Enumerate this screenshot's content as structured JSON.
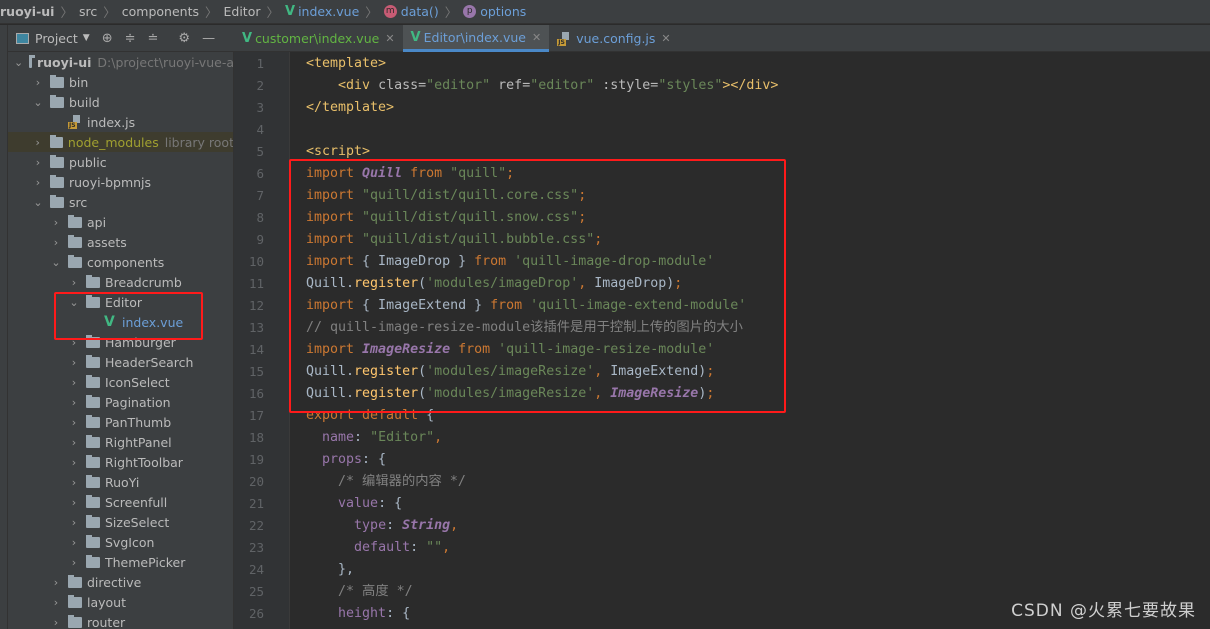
{
  "breadcrumb": {
    "items": [
      {
        "label": "ruoyi-ui",
        "icon": ""
      },
      {
        "label": "src",
        "icon": ""
      },
      {
        "label": "components",
        "icon": ""
      },
      {
        "label": "Editor",
        "icon": ""
      },
      {
        "label": "index.vue",
        "icon": "vue-icon"
      },
      {
        "label": "data()",
        "icon": "method-icon",
        "badge": "m",
        "color": "#c75b74"
      },
      {
        "label": "options",
        "icon": "property-icon",
        "badge": "p",
        "color": "#9876aa"
      }
    ]
  },
  "project_bar": {
    "label": "Project",
    "icons": [
      "locate-icon",
      "expand-all-icon",
      "collapse-all-icon",
      "gear-icon",
      "minimize-icon"
    ]
  },
  "tabs": [
    {
      "label": "customer\\index.vue",
      "icon": "vue-icon",
      "active": false,
      "color": "green"
    },
    {
      "label": "Editor\\index.vue",
      "icon": "vue-icon",
      "active": true,
      "color": "blue"
    },
    {
      "label": "vue.config.js",
      "icon": "js-icon",
      "active": false,
      "color": "blue"
    }
  ],
  "tree": [
    {
      "name": "ruoyi-ui",
      "hint": "D:\\project\\ruoyi-vue-a",
      "type": "folder",
      "depth": 0,
      "open": true,
      "bold": true
    },
    {
      "name": "bin",
      "type": "folder",
      "depth": 1,
      "open": false
    },
    {
      "name": "build",
      "type": "folder",
      "depth": 1,
      "open": true
    },
    {
      "name": "index.js",
      "type": "js",
      "depth": 2
    },
    {
      "name": "node_modules",
      "hint": "library root",
      "type": "folder",
      "depth": 1,
      "open": false,
      "lib": true
    },
    {
      "name": "public",
      "type": "folder",
      "depth": 1,
      "open": false
    },
    {
      "name": "ruoyi-bpmnjs",
      "type": "folder",
      "depth": 1,
      "open": false
    },
    {
      "name": "src",
      "type": "folder",
      "depth": 1,
      "open": true
    },
    {
      "name": "api",
      "type": "folder",
      "depth": 2,
      "open": false
    },
    {
      "name": "assets",
      "type": "folder",
      "depth": 2,
      "open": false
    },
    {
      "name": "components",
      "type": "folder",
      "depth": 2,
      "open": true
    },
    {
      "name": "Breadcrumb",
      "type": "folder",
      "depth": 3,
      "open": false
    },
    {
      "name": "Editor",
      "type": "folder",
      "depth": 3,
      "open": true
    },
    {
      "name": "index.vue",
      "type": "vue",
      "depth": 4,
      "modified": true
    },
    {
      "name": "Hamburger",
      "type": "folder",
      "depth": 3,
      "open": false
    },
    {
      "name": "HeaderSearch",
      "type": "folder",
      "depth": 3,
      "open": false
    },
    {
      "name": "IconSelect",
      "type": "folder",
      "depth": 3,
      "open": false
    },
    {
      "name": "Pagination",
      "type": "folder",
      "depth": 3,
      "open": false
    },
    {
      "name": "PanThumb",
      "type": "folder",
      "depth": 3,
      "open": false
    },
    {
      "name": "RightPanel",
      "type": "folder",
      "depth": 3,
      "open": false
    },
    {
      "name": "RightToolbar",
      "type": "folder",
      "depth": 3,
      "open": false
    },
    {
      "name": "RuoYi",
      "type": "folder",
      "depth": 3,
      "open": false
    },
    {
      "name": "Screenfull",
      "type": "folder",
      "depth": 3,
      "open": false
    },
    {
      "name": "SizeSelect",
      "type": "folder",
      "depth": 3,
      "open": false
    },
    {
      "name": "SvgIcon",
      "type": "folder",
      "depth": 3,
      "open": false
    },
    {
      "name": "ThemePicker",
      "type": "folder",
      "depth": 3,
      "open": false
    },
    {
      "name": "directive",
      "type": "folder",
      "depth": 2,
      "open": false
    },
    {
      "name": "layout",
      "type": "folder",
      "depth": 2,
      "open": false
    },
    {
      "name": "router",
      "type": "folder",
      "depth": 2,
      "open": false
    }
  ],
  "code": [
    {
      "n": "1",
      "fold": true,
      "tokens": [
        [
          "t",
          "<template>"
        ]
      ]
    },
    {
      "n": "2",
      "tokens": [
        [
          "",
          "    "
        ],
        [
          "t",
          "<div "
        ],
        [
          "a",
          "class="
        ],
        [
          "s",
          "\"editor\" "
        ],
        [
          "a",
          "ref="
        ],
        [
          "s",
          "\"editor\" "
        ],
        [
          "a",
          ":style="
        ],
        [
          "s",
          "\"styles\""
        ],
        [
          "t",
          "></div>"
        ]
      ]
    },
    {
      "n": "3",
      "fold": true,
      "tokens": [
        [
          "t",
          "</template>"
        ]
      ]
    },
    {
      "n": "4",
      "tokens": []
    },
    {
      "n": "5",
      "fold": true,
      "tokens": [
        [
          "t",
          "<script>"
        ]
      ]
    },
    {
      "n": "6",
      "fold": true,
      "tokens": [
        [
          "k",
          "import "
        ],
        [
          "ci",
          "Quill"
        ],
        [
          "k",
          " from "
        ],
        [
          "s",
          "\"quill\""
        ],
        [
          "k",
          ";"
        ]
      ]
    },
    {
      "n": "7",
      "tokens": [
        [
          "k",
          "import "
        ],
        [
          "s",
          "\"quill/dist/quill.core.css\""
        ],
        [
          "k",
          ";"
        ]
      ]
    },
    {
      "n": "8",
      "tokens": [
        [
          "k",
          "import "
        ],
        [
          "s",
          "\"quill/dist/quill.snow.css\""
        ],
        [
          "k",
          ";"
        ]
      ]
    },
    {
      "n": "9",
      "tokens": [
        [
          "k",
          "import "
        ],
        [
          "s",
          "\"quill/dist/quill.bubble.css\""
        ],
        [
          "k",
          ";"
        ]
      ]
    },
    {
      "n": "10",
      "fold": true,
      "tokens": [
        [
          "k",
          "import "
        ],
        [
          "",
          "{ ImageDrop } "
        ],
        [
          "k",
          "from "
        ],
        [
          "s",
          "'quill-image-drop-module'"
        ]
      ]
    },
    {
      "n": "11",
      "tokens": [
        [
          "",
          "Quill."
        ],
        [
          "f",
          "register"
        ],
        [
          "",
          "("
        ],
        [
          "s",
          "'modules/imageDrop'"
        ],
        [
          "k",
          ", "
        ],
        [
          "",
          "ImageDrop)"
        ],
        [
          "k",
          ";"
        ]
      ]
    },
    {
      "n": "12",
      "tokens": [
        [
          "k",
          "import "
        ],
        [
          "",
          "{ ImageExtend } "
        ],
        [
          "k",
          "from "
        ],
        [
          "s",
          "'quill-image-extend-module'"
        ]
      ]
    },
    {
      "n": "13",
      "tokens": [
        [
          "c",
          "// quill-image-resize-module该插件是用于控制上传的图片的大小"
        ]
      ]
    },
    {
      "n": "14",
      "tokens": [
        [
          "k",
          "import "
        ],
        [
          "ci",
          "ImageResize"
        ],
        [
          "k",
          " from "
        ],
        [
          "s",
          "'quill-image-resize-module'"
        ]
      ]
    },
    {
      "n": "15",
      "tokens": [
        [
          "",
          "Quill."
        ],
        [
          "f",
          "register"
        ],
        [
          "",
          "("
        ],
        [
          "s",
          "'modules/imageResize'"
        ],
        [
          "k",
          ", "
        ],
        [
          "",
          "ImageExtend)"
        ],
        [
          "k",
          ";"
        ]
      ]
    },
    {
      "n": "16",
      "tokens": [
        [
          "",
          "Quill."
        ],
        [
          "f",
          "register"
        ],
        [
          "",
          "("
        ],
        [
          "s",
          "'modules/imageResize'"
        ],
        [
          "k",
          ", "
        ],
        [
          "ci",
          "ImageResize"
        ],
        [
          "",
          ")"
        ],
        [
          "k",
          ";"
        ]
      ]
    },
    {
      "n": "17",
      "fold": true,
      "tokens": [
        [
          "k",
          "export default "
        ],
        [
          "",
          "{"
        ]
      ]
    },
    {
      "n": "18",
      "tokens": [
        [
          "",
          "  "
        ],
        [
          "p",
          "name"
        ],
        [
          "",
          ": "
        ],
        [
          "s",
          "\"Editor\""
        ],
        [
          "k",
          ","
        ]
      ]
    },
    {
      "n": "19",
      "fold": true,
      "tokens": [
        [
          "",
          "  "
        ],
        [
          "p",
          "props"
        ],
        [
          "",
          ": {"
        ]
      ]
    },
    {
      "n": "20",
      "tokens": [
        [
          "",
          "    "
        ],
        [
          "c",
          "/* 编辑器的内容 */"
        ]
      ]
    },
    {
      "n": "21",
      "fold": true,
      "tokens": [
        [
          "",
          "    "
        ],
        [
          "p",
          "value"
        ],
        [
          "",
          ": {"
        ]
      ]
    },
    {
      "n": "22",
      "tokens": [
        [
          "",
          "      "
        ],
        [
          "p",
          "type"
        ],
        [
          "",
          ": "
        ],
        [
          "ci",
          "String"
        ],
        [
          "k",
          ","
        ]
      ]
    },
    {
      "n": "23",
      "tokens": [
        [
          "",
          "      "
        ],
        [
          "p",
          "default"
        ],
        [
          "",
          ": "
        ],
        [
          "s",
          "\"\""
        ],
        [
          "k",
          ","
        ]
      ]
    },
    {
      "n": "24",
      "fold": true,
      "tokens": [
        [
          "",
          "    },"
        ]
      ]
    },
    {
      "n": "25",
      "tokens": [
        [
          "",
          "    "
        ],
        [
          "c",
          "/* 高度 */"
        ]
      ]
    },
    {
      "n": "26",
      "fold": true,
      "tokens": [
        [
          "",
          "    "
        ],
        [
          "p",
          "height"
        ],
        [
          "",
          ": {"
        ]
      ]
    }
  ],
  "watermark": "CSDN @火累七要故果"
}
